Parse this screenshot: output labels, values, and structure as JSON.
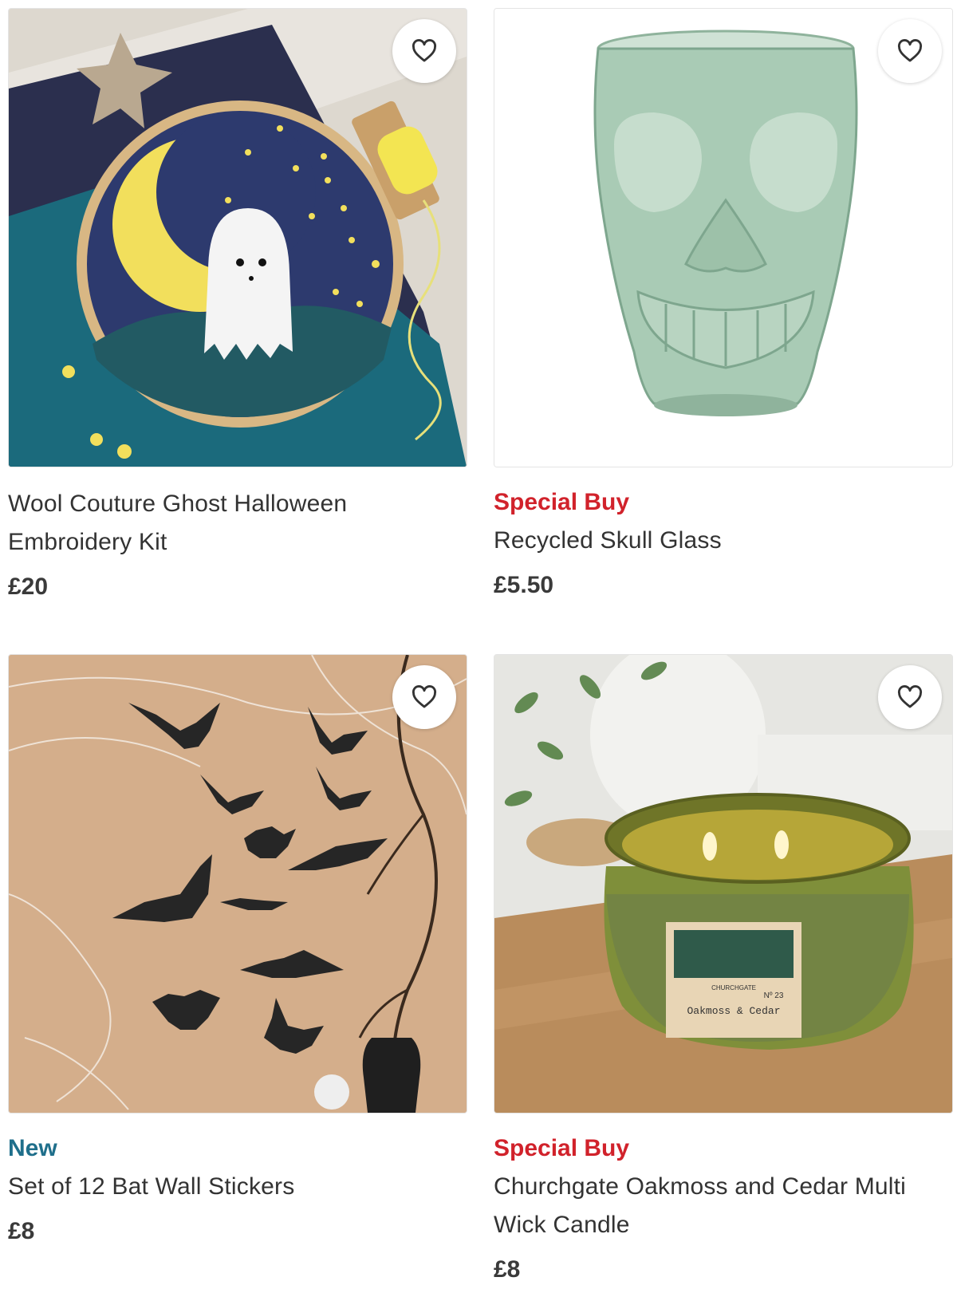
{
  "products": [
    {
      "badge": "",
      "title": "Wool Couture Ghost Halloween Embroidery Kit",
      "price": "£20",
      "image_alt": "Ghost embroidery hoop with moon and stars"
    },
    {
      "badge": "Special Buy",
      "title": "Recycled Skull Glass",
      "price": "£5.50",
      "image_alt": "Green recycled glass shaped like a skull"
    },
    {
      "badge": "New",
      "title": "Set of 12 Bat Wall Stickers",
      "price": "£8",
      "image_alt": "Black bat and moon wall stickers on a beige wall"
    },
    {
      "badge": "Special Buy",
      "title": "Churchgate Oakmoss and Cedar Multi Wick Candle",
      "price": "£8",
      "image_alt": "Green jar candle with two lit wicks",
      "label_brand": "CHURCHGATE",
      "label_number": "Nº 23",
      "label_scent": "Oakmoss & Cedar"
    }
  ],
  "icons": {
    "wishlist": "heart-outline-icon"
  },
  "colors": {
    "special_buy": "#d1222b",
    "new": "#1f6f8b",
    "text": "#333333"
  }
}
